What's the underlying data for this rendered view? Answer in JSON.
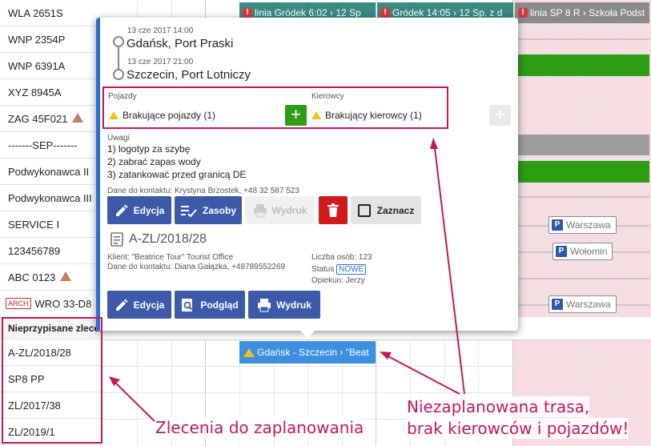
{
  "vehicles": [
    {
      "label": "WLA 2651S",
      "warn": false
    },
    {
      "label": "WNP 2354P",
      "warn": false
    },
    {
      "label": "WNP 6391A",
      "warn": false
    },
    {
      "label": "XYZ 8945A",
      "warn": false
    },
    {
      "label": "ZAG 45F021",
      "warn": true
    },
    {
      "label": "-------SEP-------",
      "warn": false
    },
    {
      "label": "Podwykonawca II",
      "warn": false
    },
    {
      "label": "Podwykonawca III",
      "warn": false
    },
    {
      "label": "SERVICE I",
      "warn": false
    },
    {
      "label": "123456789",
      "warn": false
    },
    {
      "label": "ABC 0123",
      "warn": true
    },
    {
      "label": "WRO 33-D8",
      "warn": true,
      "arch": "ARCH"
    }
  ],
  "unassigned": {
    "heading": "Nieprzypisane zlecenia",
    "orders": [
      "A-ZL/2018/28",
      "SP8 PP",
      "ZL/2017/38",
      "ZL/2019/1"
    ]
  },
  "timeline": {
    "top_bars": [
      {
        "text": "linia Gródek 6:02 › 12 Sp"
      },
      {
        "text": "Gródek 14:05 › 12 Sp. z d"
      },
      {
        "text": "linia SP 8 R › Szkoła Podst"
      }
    ],
    "places": [
      "Warszawa",
      "Wołomin",
      "Warszawa"
    ],
    "place_badge": "P",
    "unplanned_route": "Gdańsk - Szczecin › \"Beat"
  },
  "popup": {
    "stops": [
      {
        "date": "13 cze 2017 14:00",
        "name": "Gdańsk, Port Praski"
      },
      {
        "date": "13 cze 2017 21:00",
        "name": "Szczecin, Port Lotniczy"
      }
    ],
    "vehicles_label": "Pojazdy",
    "vehicles_missing": "Brakujące pojazdy (1)",
    "drivers_label": "Kierowcy",
    "drivers_missing": "Brakujący kierowcy (1)",
    "notes_label": "Uwagi",
    "notes": [
      "1) logotyp za szybę",
      "2) zabrać zapas wody",
      "3) zatankować przed granicą DE"
    ],
    "contact": "Dane do kontaktu: Krystyna Brzostek, +48 32 587 523",
    "actions1": {
      "edit": "Edycja",
      "resources": "Zasoby",
      "print": "Wydruk",
      "select": "Zaznacz"
    },
    "order": {
      "number": "A-ZL/2018/28",
      "client": "Klient: \"Beatrice Tour\" Tourist Office",
      "contact": "Dane do kontaktu: Diana Gałązka, +48789552269",
      "persons": "Liczba osób: 123",
      "status_label": "Status",
      "status": "NOWE",
      "guardian": "Opiekun: Jerzy"
    },
    "actions2": {
      "edit": "Edycja",
      "preview": "Podgląd",
      "print": "Wydruk"
    }
  },
  "annotations": {
    "orders_note": "Zlecenia do zaplanowania",
    "route_note_line1": "Niezaplanowana trasa,",
    "route_note_line2": "brak kierowców i pojazdów!"
  },
  "colors": {
    "primary": "#3c5aa8",
    "accent": "#2d6fd0",
    "success": "#2d9d14",
    "danger": "#d01a1a",
    "warning": "#f2c21b",
    "annotation": "#c2185b",
    "weekend": "#f5dde1"
  }
}
